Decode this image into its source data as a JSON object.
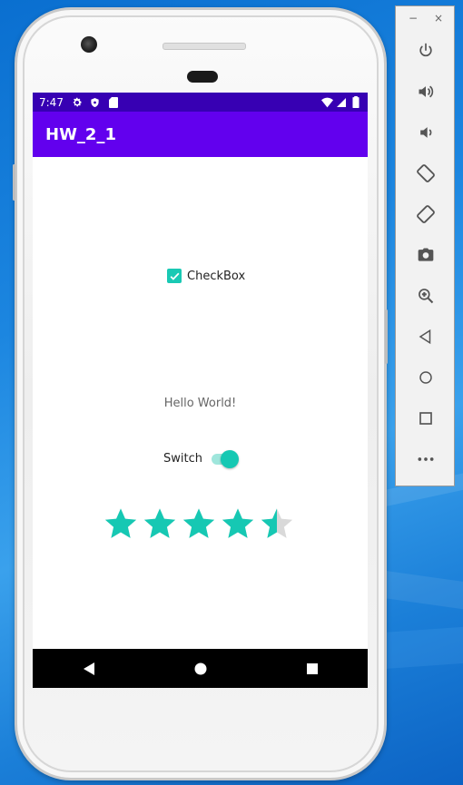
{
  "status_bar": {
    "time": "7:47"
  },
  "app_bar": {
    "title": "HW_2_1"
  },
  "checkbox": {
    "label": "CheckBox",
    "checked": true
  },
  "hello_text": "Hello World!",
  "switch": {
    "label": "Switch",
    "on": true
  },
  "rating": {
    "value": 4.5,
    "max": 5
  },
  "colors": {
    "status_bar": "#3700b3",
    "app_bar": "#6200ee",
    "accent": "#16c8b3",
    "star_empty": "#d9d9d9"
  },
  "emulator_toolbar": {
    "window_buttons": [
      "−",
      "×"
    ],
    "tools": [
      "power-icon",
      "volume-up-icon",
      "volume-down-icon",
      "rotate-left-icon",
      "rotate-right-icon",
      "camera-icon",
      "zoom-icon",
      "back-icon",
      "home-icon",
      "overview-icon",
      "more-icon"
    ]
  },
  "nav_bar": [
    "back-icon",
    "home-icon",
    "recents-icon"
  ]
}
